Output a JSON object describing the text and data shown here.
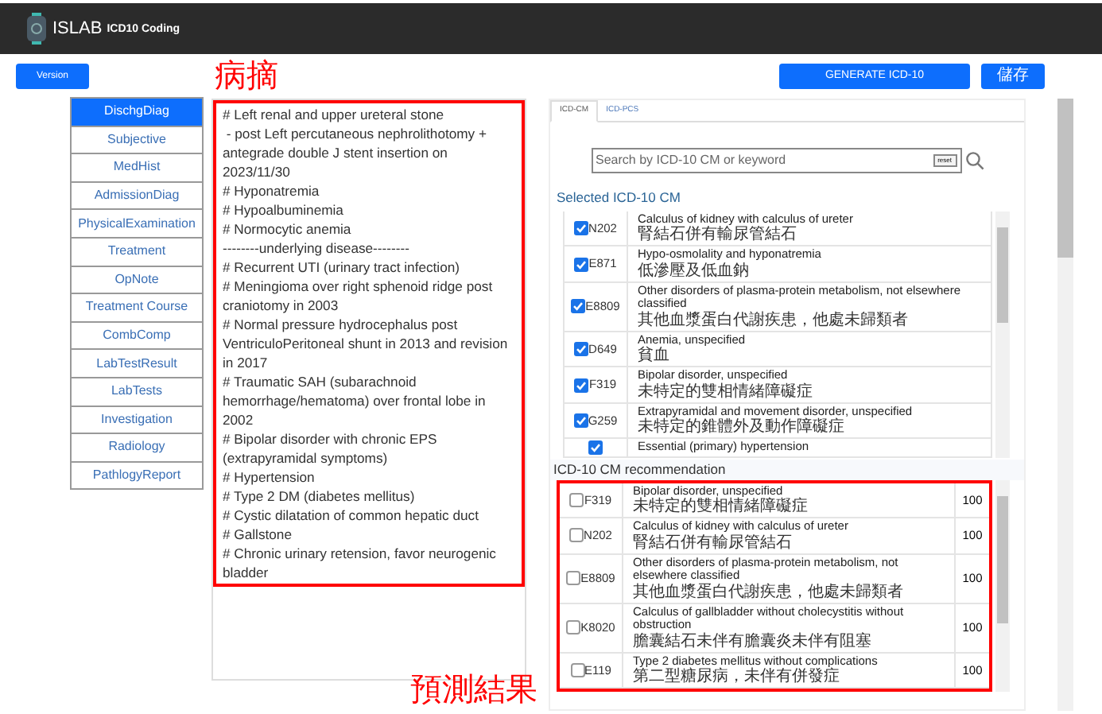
{
  "header": {
    "brand": "ISLAB",
    "subtitle": "ICD10 Coding"
  },
  "toolbar": {
    "version_button": "Version",
    "generate_button": "GENERATE ICD-10",
    "save_button": "儲存"
  },
  "sidebar": {
    "items": [
      {
        "label": "DischgDiag",
        "selected": true
      },
      {
        "label": "Subjective",
        "selected": false
      },
      {
        "label": "MedHist",
        "selected": false
      },
      {
        "label": "AdmissionDiag",
        "selected": false
      },
      {
        "label": "PhysicalExamination",
        "selected": false
      },
      {
        "label": "Treatment",
        "selected": false
      },
      {
        "label": "OpNote",
        "selected": false
      },
      {
        "label": "Treatment Course",
        "selected": false
      },
      {
        "label": "CombComp",
        "selected": false
      },
      {
        "label": "LabTestResult",
        "selected": false
      },
      {
        "label": "LabTests",
        "selected": false
      },
      {
        "label": "Investigation",
        "selected": false
      },
      {
        "label": "Radiology",
        "selected": false
      },
      {
        "label": "PathlogyReport",
        "selected": false
      }
    ]
  },
  "discharge_diagnosis": {
    "lines": [
      "# Left renal and upper ureteral stone",
      " - post Left percutaneous nephrolithotomy + antegrade double J stent insertion on 2023/11/30",
      "# Hyponatremia",
      "# Hypoalbuminemia",
      "# Normocytic anemia",
      "--------underlying disease--------",
      "# Recurrent UTI (urinary tract infection)",
      "# Meningioma over right sphenoid ridge post craniotomy in 2003",
      "# Normal pressure hydrocephalus post VentriculoPeritoneal shunt in 2013 and revision in 2017",
      "# Traumatic SAH (subarachnoid hemorrhage/hematoma) over frontal lobe in 2002",
      "# Bipolar disorder with chronic EPS (extrapyramidal symptoms)",
      "# Hypertension",
      "# Type 2 DM (diabetes mellitus)",
      "# Cystic dilatation of common hepatic duct",
      "# Gallstone",
      "# Chronic urinary retension, favor neurogenic bladder"
    ]
  },
  "annotations": [
    "病摘",
    "預測結果"
  ],
  "tabs": [
    {
      "label": "ICD-CM",
      "selected": true
    },
    {
      "label": "ICD-PCS",
      "selected": false
    }
  ],
  "search": {
    "placeholder": "Search by ICD-10 CM or keyword",
    "reset_button": "reset"
  },
  "selected_title": "Selected ICD-10 CM",
  "selected_codes": [
    {
      "code": "N202",
      "en": "Calculus of kidney with calculus of ureter",
      "zh": "腎結石併有輸尿管結石",
      "checked": true
    },
    {
      "code": "E871",
      "en": "Hypo-osmolality and hyponatremia",
      "zh": "低滲壓及低血鈉",
      "checked": true
    },
    {
      "code": "E8809",
      "en": "Other disorders of plasma-protein metabolism, not elsewhere classified",
      "zh": "其他血漿蛋白代謝疾患，他處未歸類者",
      "checked": true
    },
    {
      "code": "D649",
      "en": "Anemia, unspecified",
      "zh": "貧血",
      "checked": true
    },
    {
      "code": "F319",
      "en": "Bipolar disorder, unspecified",
      "zh": "未特定的雙相情緒障礙症",
      "checked": true
    },
    {
      "code": "G259",
      "en": "Extrapyramidal and movement disorder, unspecified",
      "zh": "未特定的錐體外及動作障礙症",
      "checked": true
    },
    {
      "en": "Essential (primary) hypertension",
      "checked": true
    }
  ],
  "recommendation_title": "ICD-10 CM recommendation",
  "recommendations": [
    {
      "code": "F319",
      "en": "Bipolar disorder, unspecified",
      "zh": "未特定的雙相情緒障礙症",
      "score": "100",
      "checked": false
    },
    {
      "code": "N202",
      "en": "Calculus of kidney with calculus of ureter",
      "zh": "腎結石併有輸尿管結石",
      "score": "100",
      "checked": false
    },
    {
      "code": "E8809",
      "en": "Other disorders of plasma-protein metabolism, not elsewhere classified",
      "zh": "其他血漿蛋白代謝疾患，他處未歸類者",
      "score": "100",
      "checked": false
    },
    {
      "code": "K8020",
      "en": "Calculus of gallbladder without cholecystitis without obstruction",
      "zh": "膽囊結石未伴有膽囊炎未伴有阻塞",
      "score": "100",
      "checked": false
    },
    {
      "code": "E119",
      "en": "Type 2 diabetes mellitus without complications",
      "zh": "第二型糖尿病，未伴有併發症",
      "score": "100",
      "checked": false
    }
  ]
}
